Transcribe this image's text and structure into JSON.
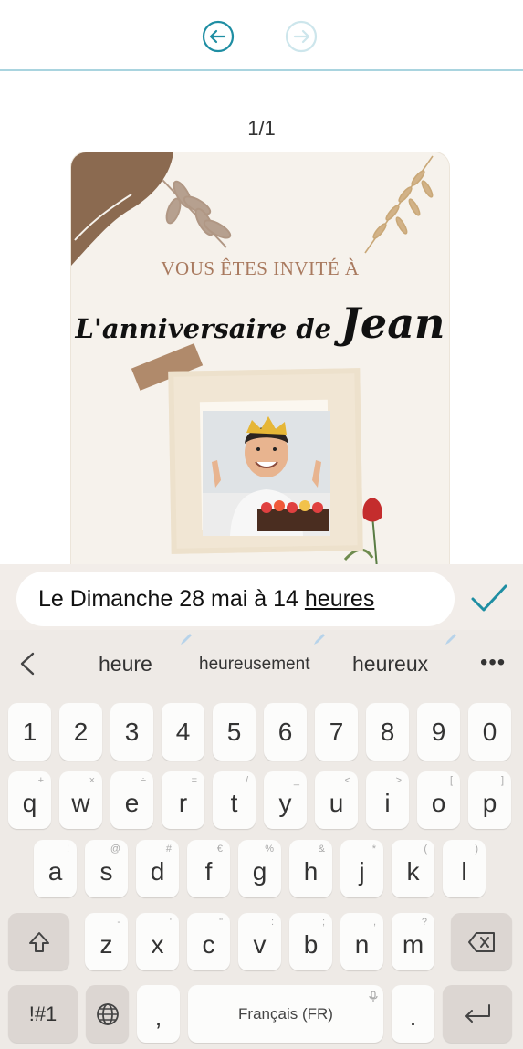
{
  "page_indicator": "1/1",
  "card": {
    "invite_line": "VOUS ÊTES INVITÉ À",
    "title_prefix": "L'anniversaire de",
    "title_name": "Jean"
  },
  "text_field": {
    "value_main": "Le Dimanche 28 mai à 14",
    "value_current_word": "heures"
  },
  "suggestions": [
    "heure",
    "heureusement",
    "heureux"
  ],
  "keyboard": {
    "number_row": [
      "1",
      "2",
      "3",
      "4",
      "5",
      "6",
      "7",
      "8",
      "9",
      "0"
    ],
    "row1": [
      {
        "key": "q",
        "hint": "+"
      },
      {
        "key": "w",
        "hint": "×"
      },
      {
        "key": "e",
        "hint": "÷"
      },
      {
        "key": "r",
        "hint": "="
      },
      {
        "key": "t",
        "hint": "/"
      },
      {
        "key": "y",
        "hint": "_"
      },
      {
        "key": "u",
        "hint": "<"
      },
      {
        "key": "i",
        "hint": ">"
      },
      {
        "key": "o",
        "hint": "["
      },
      {
        "key": "p",
        "hint": "]"
      }
    ],
    "row2": [
      {
        "key": "a",
        "hint": "!"
      },
      {
        "key": "s",
        "hint": "@"
      },
      {
        "key": "d",
        "hint": "#"
      },
      {
        "key": "f",
        "hint": "€"
      },
      {
        "key": "g",
        "hint": "%"
      },
      {
        "key": "h",
        "hint": "&"
      },
      {
        "key": "j",
        "hint": "*"
      },
      {
        "key": "k",
        "hint": "("
      },
      {
        "key": "l",
        "hint": ")"
      }
    ],
    "row3": [
      {
        "key": "z",
        "hint": "-"
      },
      {
        "key": "x",
        "hint": "'"
      },
      {
        "key": "c",
        "hint": "\""
      },
      {
        "key": "v",
        "hint": ":"
      },
      {
        "key": "b",
        "hint": ";"
      },
      {
        "key": "n",
        "hint": ","
      },
      {
        "key": "m",
        "hint": "?"
      }
    ],
    "symbols_label": "!#1",
    "comma_label": ",",
    "space_label": "Français (FR)",
    "period_label": "."
  },
  "colors": {
    "accent": "#1f8ea3",
    "toolbar_border": "#a9d4df",
    "keyboard_bg": "#eeeae6",
    "card_bg": "#f6f2ec",
    "invite_text": "#a97a5f"
  },
  "icons": {
    "undo": "undo-arrow-icon",
    "redo": "redo-arrow-icon",
    "confirm": "checkmark-icon",
    "back": "chevron-left-icon",
    "more": "more-dots-icon",
    "shift": "shift-icon",
    "delete": "backspace-icon",
    "globe": "globe-icon",
    "mic": "microphone-icon",
    "enter": "enter-icon",
    "pen": "handwriting-pen-icon"
  }
}
